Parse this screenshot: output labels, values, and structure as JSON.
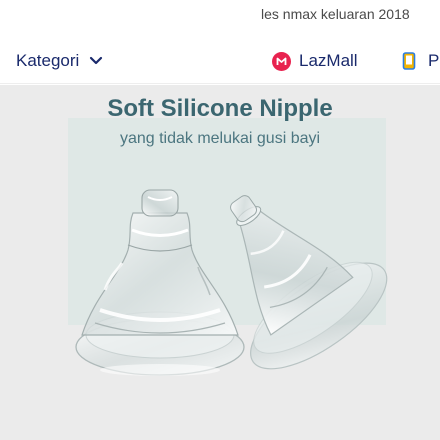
{
  "top_search": {
    "text": "les nmax keluaran 2018"
  },
  "navbar": {
    "kategori": "Kategori",
    "lazmall": "LazMall",
    "partial_item": "P"
  },
  "banner": {
    "title": "Soft Silicone Nipple",
    "subtitle": "yang tidak melukai gusi bayi"
  },
  "colors": {
    "nav_text": "#1a2a6c",
    "lazmall_badge": "#e8224f",
    "banner_bg": "#ebebeb",
    "banner_panel": "#dfe8e6",
    "banner_title": "#3b6670"
  },
  "icons": [
    "chevron-down-icon",
    "lazmall-badge-icon",
    "phone-icon"
  ]
}
